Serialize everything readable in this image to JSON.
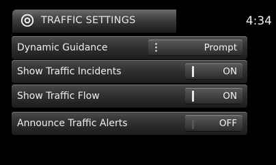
{
  "header": {
    "title": "TRAFFIC SETTINGS",
    "time": "4:34",
    "icon": "gear-icon"
  },
  "settings": [
    {
      "label": "Dynamic Guidance",
      "value": "Prompt",
      "control": "select"
    },
    {
      "label": "Show Traffic Incidents",
      "value": "ON",
      "control": "toggle",
      "state": true
    },
    {
      "label": "Show Traffic Flow",
      "value": "ON",
      "control": "toggle",
      "state": true
    },
    {
      "label": "Announce Traffic Alerts",
      "value": "OFF",
      "control": "toggle",
      "state": false
    }
  ]
}
